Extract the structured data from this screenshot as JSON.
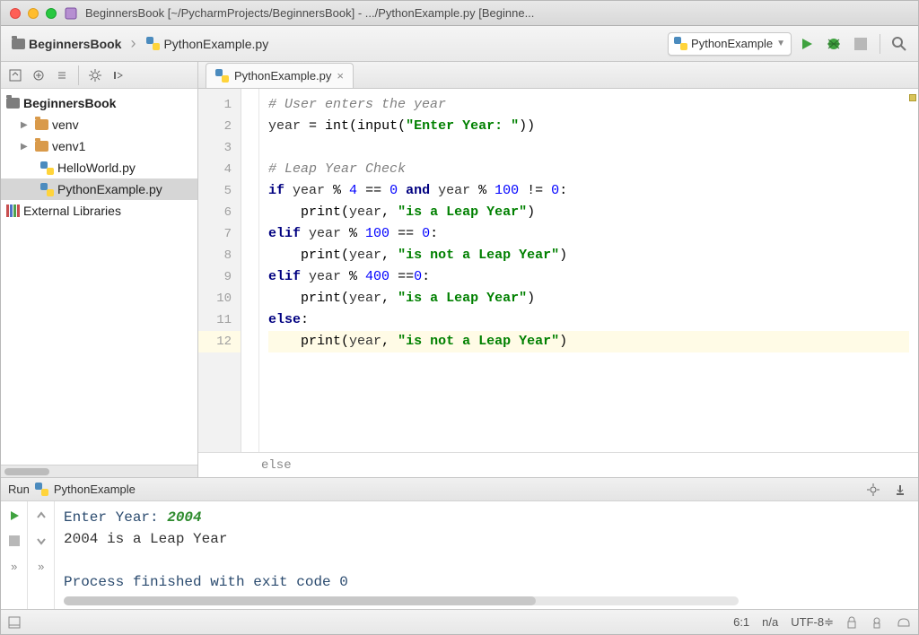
{
  "window": {
    "title": "BeginnersBook [~/PycharmProjects/BeginnersBook] - .../PythonExample.py [Beginne..."
  },
  "toolbar": {
    "breadcrumb": [
      {
        "label": "BeginnersBook",
        "bold": true
      },
      {
        "label": "PythonExample.py",
        "bold": false
      }
    ],
    "run_config": "PythonExample"
  },
  "project_tree": {
    "root": "BeginnersBook",
    "items": [
      {
        "name": "venv",
        "type": "folder"
      },
      {
        "name": "venv1",
        "type": "folder"
      },
      {
        "name": "HelloWorld.py",
        "type": "pyfile"
      },
      {
        "name": "PythonExample.py",
        "type": "pyfile",
        "selected": true
      }
    ],
    "external_label": "External Libraries"
  },
  "tabs": {
    "active": "PythonExample.py"
  },
  "editor": {
    "lines": [
      {
        "n": 1,
        "tokens": [
          [
            "c",
            "# User enters the year"
          ]
        ]
      },
      {
        "n": 2,
        "tokens": [
          [
            "p",
            "year "
          ],
          [
            "op",
            "= "
          ],
          [
            "fn",
            "int"
          ],
          [
            "op",
            "("
          ],
          [
            "fn",
            "input"
          ],
          [
            "op",
            "("
          ],
          [
            "s",
            "\"Enter Year: \""
          ],
          [
            "op",
            "))"
          ]
        ]
      },
      {
        "n": 3,
        "tokens": [
          [
            "p",
            ""
          ]
        ]
      },
      {
        "n": 4,
        "tokens": [
          [
            "c",
            "# Leap Year Check"
          ]
        ]
      },
      {
        "n": 5,
        "tokens": [
          [
            "k",
            "if "
          ],
          [
            "p",
            "year "
          ],
          [
            "op",
            "% "
          ],
          [
            "n",
            "4"
          ],
          [
            "op",
            " == "
          ],
          [
            "n",
            "0"
          ],
          [
            "k",
            " and "
          ],
          [
            "p",
            "year "
          ],
          [
            "op",
            "% "
          ],
          [
            "n",
            "100"
          ],
          [
            "op",
            " != "
          ],
          [
            "n",
            "0"
          ],
          [
            "op",
            ":"
          ]
        ]
      },
      {
        "n": 6,
        "tokens": [
          [
            "p",
            "    "
          ],
          [
            "fn",
            "print"
          ],
          [
            "op",
            "("
          ],
          [
            "p",
            "year"
          ],
          [
            "op",
            ", "
          ],
          [
            "s",
            "\"is a Leap Year\""
          ],
          [
            "op",
            ")"
          ]
        ]
      },
      {
        "n": 7,
        "tokens": [
          [
            "k",
            "elif "
          ],
          [
            "p",
            "year "
          ],
          [
            "op",
            "% "
          ],
          [
            "n",
            "100"
          ],
          [
            "op",
            " == "
          ],
          [
            "n",
            "0"
          ],
          [
            "op",
            ":"
          ]
        ]
      },
      {
        "n": 8,
        "tokens": [
          [
            "p",
            "    "
          ],
          [
            "fn",
            "print"
          ],
          [
            "op",
            "("
          ],
          [
            "p",
            "year"
          ],
          [
            "op",
            ", "
          ],
          [
            "s",
            "\"is not a Leap Year\""
          ],
          [
            "op",
            ")"
          ]
        ]
      },
      {
        "n": 9,
        "tokens": [
          [
            "k",
            "elif "
          ],
          [
            "p",
            "year "
          ],
          [
            "op",
            "% "
          ],
          [
            "n",
            "400"
          ],
          [
            "op",
            " =="
          ],
          [
            "n",
            "0"
          ],
          [
            "op",
            ":"
          ]
        ]
      },
      {
        "n": 10,
        "tokens": [
          [
            "p",
            "    "
          ],
          [
            "fn",
            "print"
          ],
          [
            "op",
            "("
          ],
          [
            "p",
            "year"
          ],
          [
            "op",
            ", "
          ],
          [
            "s",
            "\"is a Leap Year\""
          ],
          [
            "op",
            ")"
          ]
        ]
      },
      {
        "n": 11,
        "tokens": [
          [
            "k",
            "else"
          ],
          [
            "op",
            ":"
          ]
        ]
      },
      {
        "n": 12,
        "tokens": [
          [
            "p",
            "    "
          ],
          [
            "fn",
            "print"
          ],
          [
            "op",
            "("
          ],
          [
            "p",
            "year"
          ],
          [
            "op",
            ", "
          ],
          [
            "s",
            "\"is not a Leap Year\""
          ],
          [
            "op",
            ")"
          ]
        ],
        "current": true
      }
    ],
    "breadcrumb_bottom": "else"
  },
  "run": {
    "title_prefix": "Run",
    "config": "PythonExample",
    "console": {
      "prompt_label": "Enter Year: ",
      "user_input": "2004",
      "output_line": "2004 is a Leap Year",
      "exit_line": "Process finished with exit code 0"
    }
  },
  "status": {
    "cursor": "6:1",
    "insert": "n/a",
    "encoding": "UTF-8",
    "encoding_suffix": "≑"
  }
}
